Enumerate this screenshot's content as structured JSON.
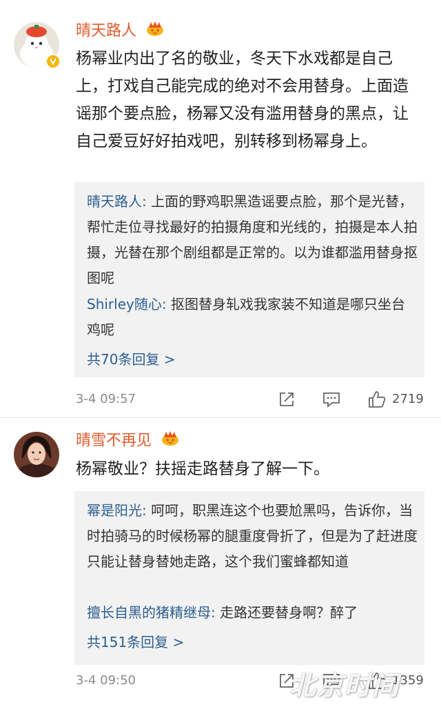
{
  "comments": [
    {
      "username": "晴天路人",
      "text": "杨幂业内出了名的敬业，冬天下水戏都是自己上，打戏自己能完成的绝对不会用替身。上面造谣那个要点脸，杨幂又没有滥用替身的黑点，让自己爱豆好好拍戏吧，别转移到杨幂身上。",
      "replies": [
        {
          "author": "晴天路人",
          "sep": ": ",
          "text": "上面的野鸡职黑造谣要点脸，那个是光替，帮忙走位寻找最好的拍摄角度和光线的，拍摄是本人拍摄，光替在那个剧组都是正常的。以为谁都滥用替身抠图呢"
        },
        {
          "author": "Shirley随心",
          "sep": ": ",
          "text": "抠图替身轧戏我家装不知道是哪只坐台鸡呢"
        }
      ],
      "more_replies": "共70条回复 >",
      "time": "3-4 09:57",
      "likes": "2719"
    },
    {
      "username": "晴雪不再见",
      "text": "杨幂敬业？扶摇走路替身了解一下。",
      "replies": [
        {
          "author": "幂是阳光",
          "sep": ": ",
          "text": "呵呵，职黑连这个也要尬黑吗，告诉你，当时拍骑马的时候杨幂的腿重度骨折了，但是为了赶进度只能让替身替她走路，这个我们蜜蜂都知道"
        },
        {
          "author": "擅长自黑的猪精继母",
          "sep": ": ",
          "text": "走路还要替身啊？醉了"
        }
      ],
      "more_replies": "共151条回复 >",
      "time": "3-4 09:50",
      "likes": "1359"
    }
  ],
  "watermark": "北京时间",
  "icons": {
    "share": "share-icon",
    "comment": "comment-icon",
    "like": "thumbs-up-icon",
    "crown": "crown-badge-icon",
    "verified": "verified-badge-icon"
  },
  "colors": {
    "username": "#e05a2b",
    "reply_author": "#2b5f91",
    "reply_bg": "#f2f2f2",
    "verified": "#f7b500"
  }
}
